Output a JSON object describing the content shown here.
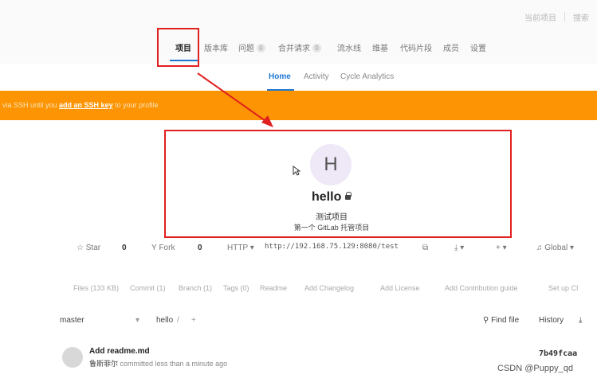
{
  "top_right": {
    "link1": "当前项目",
    "link2": "搜索"
  },
  "main_nav": {
    "items": [
      {
        "label": "项目",
        "active": true
      },
      {
        "label": "版本库"
      },
      {
        "label": "问题",
        "count": "0"
      },
      {
        "label": "合并请求",
        "count": "0"
      },
      {
        "label": "流水线"
      },
      {
        "label": "维基"
      },
      {
        "label": "代码片段"
      },
      {
        "label": "成员"
      },
      {
        "label": "设置"
      }
    ]
  },
  "sub_nav": {
    "home": "Home",
    "activity": "Activity",
    "cycle": "Cycle Analytics"
  },
  "banner": {
    "pre": "via SSH until you ",
    "link": "add an SSH key",
    "post": " to your profile"
  },
  "project": {
    "avatar_letter": "H",
    "name": "hello",
    "desc1": "测试项目",
    "desc2": "第一个 GitLab 托管项目"
  },
  "actions": {
    "star": "Star",
    "star_count": "0",
    "fork": "Fork",
    "fork_count": "0",
    "protocol": "HTTP",
    "url": "http://192.168.75.129:8080/test",
    "notify": "Global"
  },
  "links": {
    "files": "Files (133 KB)",
    "commit": "Commit (1)",
    "branch": "Branch (1)",
    "tags": "Tags (0)",
    "readme": "Readme",
    "changelog": "Add Changelog",
    "license": "Add License",
    "contrib": "Add Contribution guide",
    "ci": "Set up CI"
  },
  "branch_row": {
    "branch": "master",
    "path": "hello",
    "path_sep": "/",
    "plus": "+",
    "find_file": "Find file",
    "history": "History"
  },
  "commit": {
    "title": "Add readme.md",
    "author": "鲁斯菲尔",
    "meta": " committed less than a minute ago",
    "sha": "7b49fcaa"
  },
  "watermark": "CSDN @Puppy_qd",
  "colors": {
    "accent": "#1f78d1",
    "banner": "#fc9403",
    "highlight": "#e0201e"
  }
}
